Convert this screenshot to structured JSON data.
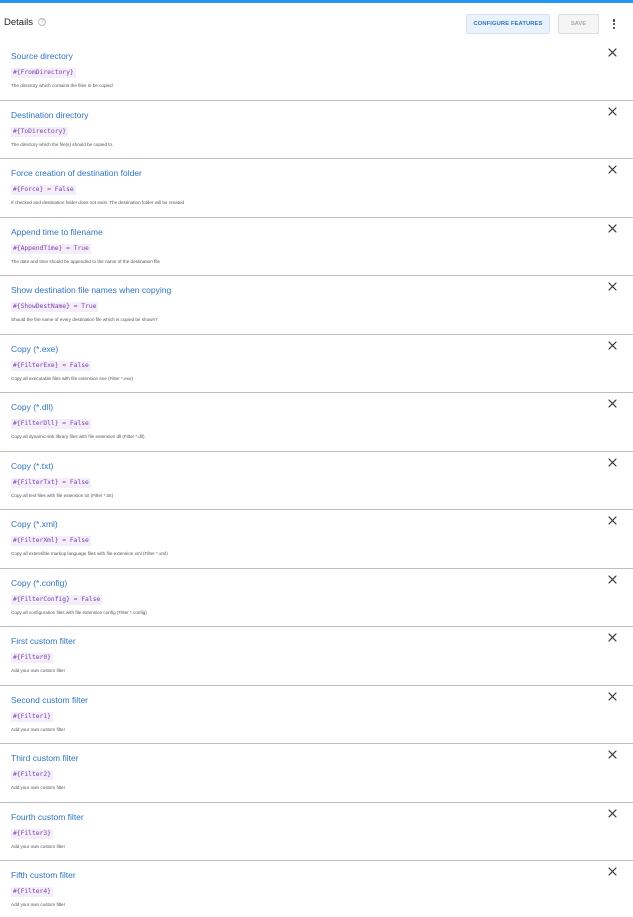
{
  "header": {
    "title": "Details",
    "configure_label": "CONFIGURE FEATURES",
    "save_label": "SAVE"
  },
  "items": [
    {
      "title": "Source directory",
      "var": "#{FromDirectory}",
      "desc": "The directory which contains the files to be copied"
    },
    {
      "title": "Destination directory",
      "var": "#{ToDirectory}",
      "desc": "The directory which the file(s) should be copied to."
    },
    {
      "title": "Force creation of destination folder",
      "var": "#{Force} = False",
      "desc": "If checked and destination folder does not exist. The destination folder will be created"
    },
    {
      "title": "Append time to filename",
      "var": "#{AppendTime} = True",
      "desc": "The date and time should be appended to the name of the destination file"
    },
    {
      "title": "Show destination file names when copying",
      "var": "#{ShowDestName} = True",
      "desc": "Should the the name of every destination file which is copied be shown?"
    },
    {
      "title": "Copy (*.exe)",
      "var": "#{FilterExe} = False",
      "desc": "Copy all executable files with file extension exe (Filter *.exe)"
    },
    {
      "title": "Copy (*.dll)",
      "var": "#{FilterDll} = False",
      "desc": "Copy all dynamic-link library files with file extension dll (Filter *.dll)"
    },
    {
      "title": "Copy (*.txt)",
      "var": "#{FilterTxt} = False",
      "desc": "Copy all text files with file extension txt (Filter *.txt)"
    },
    {
      "title": "Copy (*.xml)",
      "var": "#{FilterXml} = False",
      "desc": "Copy all extensible markup language files with file extension xml (Filter *.xml)"
    },
    {
      "title": "Copy (*.config)",
      "var": "#{FilterConfig} = False",
      "desc": "Copy all configuration files with file extension config (Filter *.config)"
    },
    {
      "title": "First custom filter",
      "var": "#{Filter0}",
      "desc": "Add your own custom filter"
    },
    {
      "title": "Second custom filter",
      "var": "#{Filter1}",
      "desc": "Add your own custom filter"
    },
    {
      "title": "Third custom filter",
      "var": "#{Filter2}",
      "desc": "Add your own custom filter"
    },
    {
      "title": "Fourth custom filter",
      "var": "#{Filter3}",
      "desc": "Add your own custom filter"
    },
    {
      "title": "Fifth custom filter",
      "var": "#{Filter4}",
      "desc": "Add your own custom filter"
    }
  ],
  "icons": {
    "info": "info-icon",
    "close": "close-icon",
    "more": "kebab-menu-icon"
  },
  "colors": {
    "accent": "#2196f3",
    "title": "#2f74c0",
    "variable": "#7a3fb0"
  }
}
